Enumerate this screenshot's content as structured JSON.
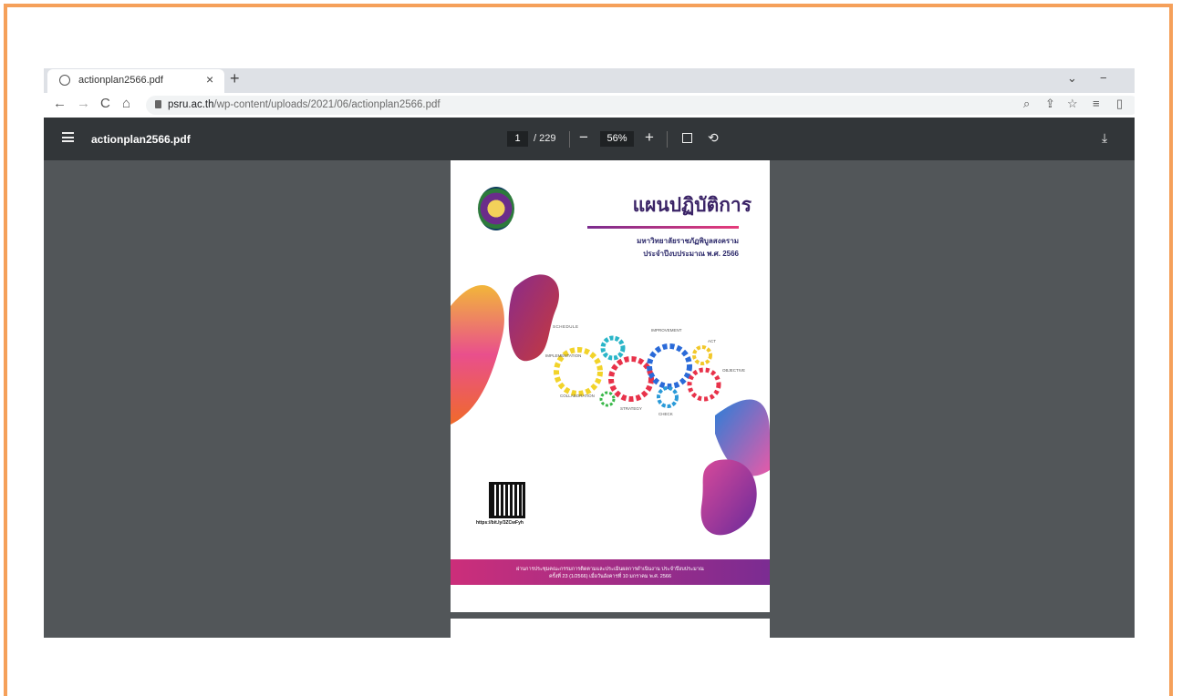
{
  "tab": {
    "title": "actionplan2566.pdf",
    "close": "×",
    "new": "+"
  },
  "window": {
    "chevron": "⌄",
    "minimize": "−"
  },
  "nav": {
    "back": "←",
    "forward": "→",
    "reload": "C",
    "home": "⌂"
  },
  "address": {
    "domain": "psru.ac.th",
    "path": "/wp-content/uploads/2021/06/actionplan2566.pdf"
  },
  "toolbar_icons": [
    "zoom-icon",
    "share-icon",
    "star-icon",
    "reading-list-icon",
    "side-panel-icon"
  ],
  "pdf": {
    "filename": "actionplan2566.pdf",
    "page": "1",
    "page_total": "/ 229",
    "zoom": "56%",
    "minus": "−",
    "plus": "+"
  },
  "cover": {
    "title": "แผนปฏิบัติการ",
    "subtitle1": "มหาวิทยาลัยราชภัฏพิบูลสงคราม",
    "subtitle2": "ประจำปีงบประมาณ พ.ศ. 2566",
    "gear_words": [
      "SCHEDULE",
      "IMPROVEMENT",
      "ACT",
      "IMPLEMENTATION",
      "OBJECTIVE",
      "COLLABORATION",
      "STRATEGY",
      "CHECK"
    ],
    "qr_url": "https://bit.ly/3ZCwFyh",
    "footer1": "ผ่านการประชุมคณะกรรมการติดตามและประเมินผลการดำเนินงาน ประจำปีงบประมาณ",
    "footer2": "ครั้งที่ 23 (1/2566) เมื่อวันอังคารที่ 10 มกราคม พ.ศ. 2566"
  },
  "colors": {
    "frame": "#f5a05a",
    "viewer_bg": "#525659",
    "pdf_toolbar": "#323639"
  }
}
